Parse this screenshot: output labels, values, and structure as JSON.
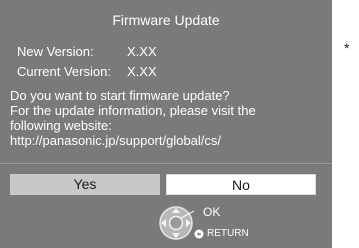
{
  "dialog": {
    "title": "Firmware Update",
    "new_version_label": "New Version:",
    "new_version_value": "X.XX",
    "current_version_label": "Current Version:",
    "current_version_value": "X.XX",
    "message_lines": [
      "Do you want to start firmware update?",
      "For the update information, please visit the",
      "following website:",
      "http://panasonic.jp/support/global/cs/"
    ],
    "yes_label": "Yes",
    "no_label": "No",
    "ok_label": "OK",
    "return_label": "RETURN"
  },
  "annotation": {
    "asterisk": "*"
  },
  "icons": {
    "nav": "directional-pad-icon",
    "return": "return-icon"
  },
  "colors": {
    "dialog_bg": "#7a7a7a",
    "selected_button_bg": "#c8c8c8",
    "button_bg": "#ffffff",
    "text": "#ffffff"
  }
}
